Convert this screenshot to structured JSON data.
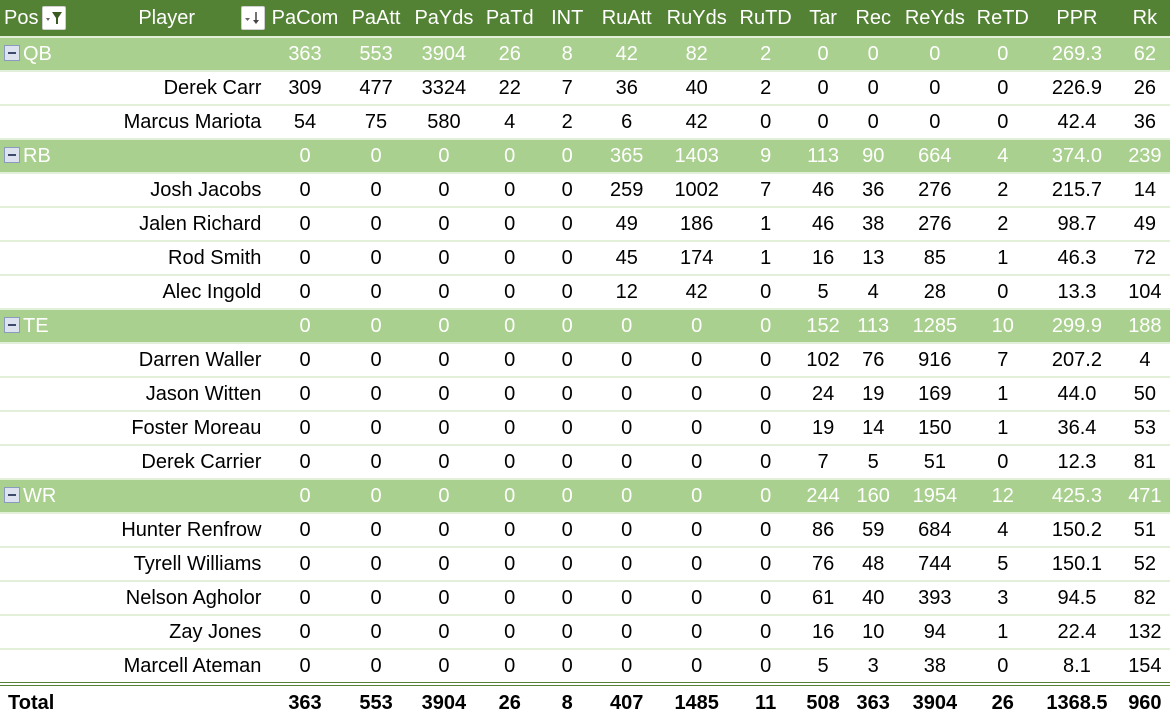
{
  "colors": {
    "header_bg": "#548235",
    "group_bg": "#a9d08e",
    "row_separator": "#e2efd9"
  },
  "header": {
    "pos_label": "Pos",
    "pos_filter_icon": "filter-dropdown-icon",
    "player_label": "Player",
    "player_sort_icon": "sort-descending-icon",
    "columns": [
      "PaCom",
      "PaAtt",
      "PaYds",
      "PaTd",
      "INT",
      "RuAtt",
      "RuYds",
      "RuTD",
      "Tar",
      "Rec",
      "ReYds",
      "ReTD",
      "PPR",
      "Rk"
    ]
  },
  "groups": [
    {
      "name": "QB",
      "collapse_icon": "collapse-minus-icon",
      "totals": [
        "363",
        "553",
        "3904",
        "26",
        "8",
        "42",
        "82",
        "2",
        "0",
        "0",
        "0",
        "0",
        "269.3",
        "62"
      ],
      "players": [
        {
          "name": "Derek Carr",
          "values": [
            "309",
            "477",
            "3324",
            "22",
            "7",
            "36",
            "40",
            "2",
            "0",
            "0",
            "0",
            "0",
            "226.9",
            "26"
          ]
        },
        {
          "name": "Marcus Mariota",
          "values": [
            "54",
            "75",
            "580",
            "4",
            "2",
            "6",
            "42",
            "0",
            "0",
            "0",
            "0",
            "0",
            "42.4",
            "36"
          ]
        }
      ]
    },
    {
      "name": "RB",
      "collapse_icon": "collapse-minus-icon",
      "totals": [
        "0",
        "0",
        "0",
        "0",
        "0",
        "365",
        "1403",
        "9",
        "113",
        "90",
        "664",
        "4",
        "374.0",
        "239"
      ],
      "players": [
        {
          "name": "Josh Jacobs",
          "values": [
            "0",
            "0",
            "0",
            "0",
            "0",
            "259",
            "1002",
            "7",
            "46",
            "36",
            "276",
            "2",
            "215.7",
            "14"
          ]
        },
        {
          "name": "Jalen Richard",
          "values": [
            "0",
            "0",
            "0",
            "0",
            "0",
            "49",
            "186",
            "1",
            "46",
            "38",
            "276",
            "2",
            "98.7",
            "49"
          ]
        },
        {
          "name": "Rod Smith",
          "values": [
            "0",
            "0",
            "0",
            "0",
            "0",
            "45",
            "174",
            "1",
            "16",
            "13",
            "85",
            "1",
            "46.3",
            "72"
          ]
        },
        {
          "name": "Alec Ingold",
          "values": [
            "0",
            "0",
            "0",
            "0",
            "0",
            "12",
            "42",
            "0",
            "5",
            "4",
            "28",
            "0",
            "13.3",
            "104"
          ]
        }
      ]
    },
    {
      "name": "TE",
      "collapse_icon": "collapse-minus-icon",
      "totals": [
        "0",
        "0",
        "0",
        "0",
        "0",
        "0",
        "0",
        "0",
        "152",
        "113",
        "1285",
        "10",
        "299.9",
        "188"
      ],
      "players": [
        {
          "name": "Darren Waller",
          "values": [
            "0",
            "0",
            "0",
            "0",
            "0",
            "0",
            "0",
            "0",
            "102",
            "76",
            "916",
            "7",
            "207.2",
            "4"
          ]
        },
        {
          "name": "Jason Witten",
          "values": [
            "0",
            "0",
            "0",
            "0",
            "0",
            "0",
            "0",
            "0",
            "24",
            "19",
            "169",
            "1",
            "44.0",
            "50"
          ]
        },
        {
          "name": "Foster Moreau",
          "values": [
            "0",
            "0",
            "0",
            "0",
            "0",
            "0",
            "0",
            "0",
            "19",
            "14",
            "150",
            "1",
            "36.4",
            "53"
          ]
        },
        {
          "name": "Derek Carrier",
          "values": [
            "0",
            "0",
            "0",
            "0",
            "0",
            "0",
            "0",
            "0",
            "7",
            "5",
            "51",
            "0",
            "12.3",
            "81"
          ]
        }
      ]
    },
    {
      "name": "WR",
      "collapse_icon": "collapse-minus-icon",
      "totals": [
        "0",
        "0",
        "0",
        "0",
        "0",
        "0",
        "0",
        "0",
        "244",
        "160",
        "1954",
        "12",
        "425.3",
        "471"
      ],
      "players": [
        {
          "name": "Hunter Renfrow",
          "values": [
            "0",
            "0",
            "0",
            "0",
            "0",
            "0",
            "0",
            "0",
            "86",
            "59",
            "684",
            "4",
            "150.2",
            "51"
          ]
        },
        {
          "name": "Tyrell Williams",
          "values": [
            "0",
            "0",
            "0",
            "0",
            "0",
            "0",
            "0",
            "0",
            "76",
            "48",
            "744",
            "5",
            "150.1",
            "52"
          ]
        },
        {
          "name": "Nelson Agholor",
          "values": [
            "0",
            "0",
            "0",
            "0",
            "0",
            "0",
            "0",
            "0",
            "61",
            "40",
            "393",
            "3",
            "94.5",
            "82"
          ]
        },
        {
          "name": "Zay Jones",
          "values": [
            "0",
            "0",
            "0",
            "0",
            "0",
            "0",
            "0",
            "0",
            "16",
            "10",
            "94",
            "1",
            "22.4",
            "132"
          ]
        },
        {
          "name": "Marcell Ateman",
          "values": [
            "0",
            "0",
            "0",
            "0",
            "0",
            "0",
            "0",
            "0",
            "5",
            "3",
            "38",
            "0",
            "8.1",
            "154"
          ]
        }
      ]
    }
  ],
  "total": {
    "label": "Total",
    "values": [
      "363",
      "553",
      "3904",
      "26",
      "8",
      "407",
      "1485",
      "11",
      "508",
      "363",
      "3904",
      "26",
      "1368.5",
      "960"
    ]
  }
}
